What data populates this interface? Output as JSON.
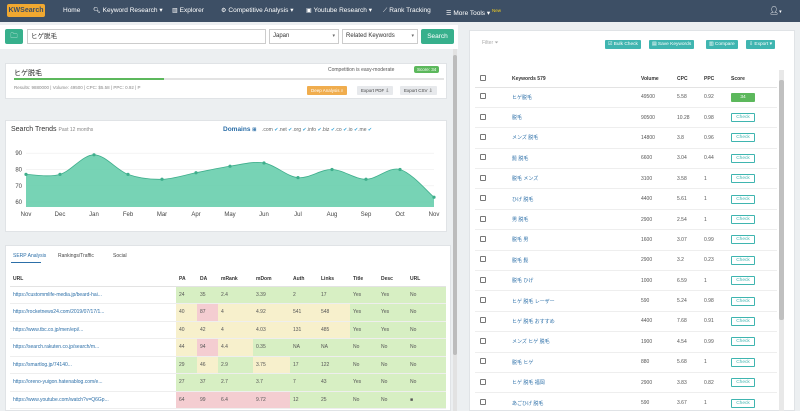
{
  "nav": {
    "logo": "KWSearch",
    "items": [
      {
        "label": "Home"
      },
      {
        "label": "Keyword Research",
        "icon": "search-icon",
        "caret": "▾"
      },
      {
        "label": "Explorer",
        "icon": "bar-chart-icon"
      },
      {
        "label": "Competitive Analysis",
        "icon": "gear-icon",
        "caret": "▾"
      },
      {
        "label": "Youtube Research",
        "icon": "video-icon",
        "caret": "▾"
      },
      {
        "label": "Rank Tracking",
        "icon": "line-chart-icon"
      },
      {
        "label": "More Tools",
        "icon": "bars-icon",
        "caret": "▾",
        "badge": "New"
      }
    ],
    "user_caret": "▾"
  },
  "search": {
    "keyword": "ヒゲ脱毛",
    "country": "Japan",
    "type": "Related Keywords",
    "button": "Search"
  },
  "summary": {
    "keyword": "ヒゲ脱毛",
    "stats": "Results: 9880000 | Volume: 49500 | CPC: $5.58 | PPC: 0.92 | P",
    "competition_text": "Competition is easy-moderate",
    "score_badge": "Score: 34",
    "deep_analysis": "Deep Analysis",
    "export_pdf": "Export PDF",
    "export_csv": "Export CSV"
  },
  "trends": {
    "title": "Search Trends",
    "subtitle": "Past 12 months",
    "domains_label": "Domains",
    "domains": [
      ".com",
      ".net",
      ".org",
      ".info",
      ".biz",
      ".co",
      ".io",
      ".me"
    ]
  },
  "chart_data": {
    "type": "area",
    "title": "Search Trends",
    "x": [
      "Nov",
      "Dec",
      "Jan",
      "Feb",
      "Mar",
      "Apr",
      "May",
      "Jun",
      "Jul",
      "Aug",
      "Sep",
      "Oct",
      "Nov"
    ],
    "values": [
      77,
      77,
      89,
      77,
      74,
      78,
      82,
      84,
      75,
      80,
      74,
      80,
      63
    ],
    "yticks": [
      60,
      70,
      80,
      90
    ],
    "ylim": [
      57,
      95
    ],
    "color": "#5fcba8",
    "grid": true
  },
  "serp": {
    "tabs": [
      "SERP Analysis",
      "Rankings/Traffic",
      "Social"
    ],
    "columns": [
      "URL",
      "PA",
      "DA",
      "mRank",
      "mDom",
      "Auth",
      "Links",
      "Title",
      "Desc",
      "URL"
    ],
    "rows": [
      {
        "url": "https://custommlife-media.jp/beard-hai...",
        "pa": "24",
        "da": "35",
        "mrank": "2.4",
        "mdom": "3.39",
        "auth": "2",
        "links": "17",
        "title": "Yes",
        "desc": "Yes",
        "urlc": "No",
        "classes": [
          "g",
          "g",
          "g",
          "g",
          "g",
          "g",
          "g",
          "g",
          "g"
        ]
      },
      {
        "url": "https://rocketnews24.com/2019/07/17/1...",
        "pa": "40",
        "da": "87",
        "mrank": "4",
        "mdom": "4.92",
        "auth": "541",
        "links": "548",
        "title": "Yes",
        "desc": "Yes",
        "urlc": "No",
        "classes": [
          "y",
          "r",
          "y",
          "y",
          "y",
          "y",
          "g",
          "g",
          "g"
        ]
      },
      {
        "url": "https://www.tbc.co.jp/men/epi/...",
        "pa": "40",
        "da": "42",
        "mrank": "4",
        "mdom": "4.03",
        "auth": "131",
        "links": "485",
        "title": "Yes",
        "desc": "Yes",
        "urlc": "No",
        "classes": [
          "y",
          "y",
          "y",
          "y",
          "y",
          "y",
          "g",
          "g",
          "g"
        ]
      },
      {
        "url": "https://search.rakuten.co.jp/search/m...",
        "pa": "44",
        "da": "94",
        "mrank": "4.4",
        "mdom": "0.35",
        "auth": "NA",
        "links": "NA",
        "title": "No",
        "desc": "No",
        "urlc": "No",
        "classes": [
          "y",
          "r",
          "y",
          "g",
          "g",
          "g",
          "g",
          "g",
          "g"
        ]
      },
      {
        "url": "https://smartlog.jp/74140...",
        "pa": "29",
        "da": "46",
        "mrank": "2.9",
        "mdom": "3.75",
        "auth": "17",
        "links": "122",
        "title": "No",
        "desc": "No",
        "urlc": "No",
        "classes": [
          "g",
          "y",
          "g",
          "y",
          "g",
          "g",
          "g",
          "g",
          "g"
        ]
      },
      {
        "url": "https://oreno-yuigon.hatenablog.com/e...",
        "pa": "27",
        "da": "37",
        "mrank": "2.7",
        "mdom": "3.7",
        "auth": "7",
        "links": "43",
        "title": "Yes",
        "desc": "No",
        "urlc": "No",
        "classes": [
          "g",
          "g",
          "g",
          "g",
          "g",
          "g",
          "g",
          "g",
          "g"
        ]
      },
      {
        "url": "https://www.youtube.com/watch?v=Q6Gp...",
        "pa": "64",
        "da": "99",
        "mrank": "6.4",
        "mdom": "9.72",
        "auth": "12",
        "links": "25",
        "title": "No",
        "desc": "No",
        "urlc": "■",
        "classes": [
          "r",
          "r",
          "r",
          "r",
          "g",
          "g",
          "g",
          "g",
          "g"
        ]
      }
    ]
  },
  "right": {
    "filter": "Filter",
    "buttons": [
      "Bulk Check",
      "Save Keywords",
      "Compare",
      "Export"
    ],
    "columns": [
      "Keywords 579",
      "Volume",
      "CPC",
      "PPC",
      "Score"
    ],
    "rows": [
      {
        "kw": "ヒゲ脱毛",
        "vol": "49500",
        "cpc": "5.58",
        "ppc": "0.92",
        "score": "34"
      },
      {
        "kw": "脱毛",
        "vol": "90500",
        "cpc": "10.28",
        "ppc": "0.98",
        "score": "Check"
      },
      {
        "kw": "メンズ 脱毛",
        "vol": "14800",
        "cpc": "3.8",
        "ppc": "0.96",
        "score": "Check"
      },
      {
        "kw": "髭 脱毛",
        "vol": "6600",
        "cpc": "3.04",
        "ppc": "0.44",
        "score": "Check"
      },
      {
        "kw": "脱毛 メンズ",
        "vol": "3100",
        "cpc": "3.58",
        "ppc": "1",
        "score": "Check"
      },
      {
        "kw": "ひげ 脱毛",
        "vol": "4400",
        "cpc": "5.61",
        "ppc": "1",
        "score": "Check"
      },
      {
        "kw": "男 脱毛",
        "vol": "2900",
        "cpc": "2.54",
        "ppc": "1",
        "score": "Check"
      },
      {
        "kw": "脱毛 男",
        "vol": "1600",
        "cpc": "3.07",
        "ppc": "0.99",
        "score": "Check"
      },
      {
        "kw": "脱毛 髭",
        "vol": "2900",
        "cpc": "3.2",
        "ppc": "0.23",
        "score": "Check"
      },
      {
        "kw": "脱毛 ひげ",
        "vol": "1000",
        "cpc": "6.59",
        "ppc": "1",
        "score": "Check"
      },
      {
        "kw": "ヒゲ 脱毛 レーザー",
        "vol": "590",
        "cpc": "5.24",
        "ppc": "0.98",
        "score": "Check"
      },
      {
        "kw": "ヒゲ 脱毛 おすすめ",
        "vol": "4400",
        "cpc": "7.68",
        "ppc": "0.91",
        "score": "Check"
      },
      {
        "kw": "メンズ ヒゲ 脱毛",
        "vol": "1900",
        "cpc": "4.54",
        "ppc": "0.99",
        "score": "Check"
      },
      {
        "kw": "脱毛 ヒゲ",
        "vol": "880",
        "cpc": "5.68",
        "ppc": "1",
        "score": "Check"
      },
      {
        "kw": "ヒゲ 脱毛 福岡",
        "vol": "2900",
        "cpc": "3.83",
        "ppc": "0.82",
        "score": "Check"
      },
      {
        "kw": "あごひげ 脱毛",
        "vol": "590",
        "cpc": "3.67",
        "ppc": "1",
        "score": "Check"
      }
    ]
  },
  "colors": {
    "nav": "#3d4f65",
    "accent": "#37b08c",
    "teal": "#3fb5b0",
    "score_green": "#5cb85c",
    "link": "#2c6fa8"
  }
}
